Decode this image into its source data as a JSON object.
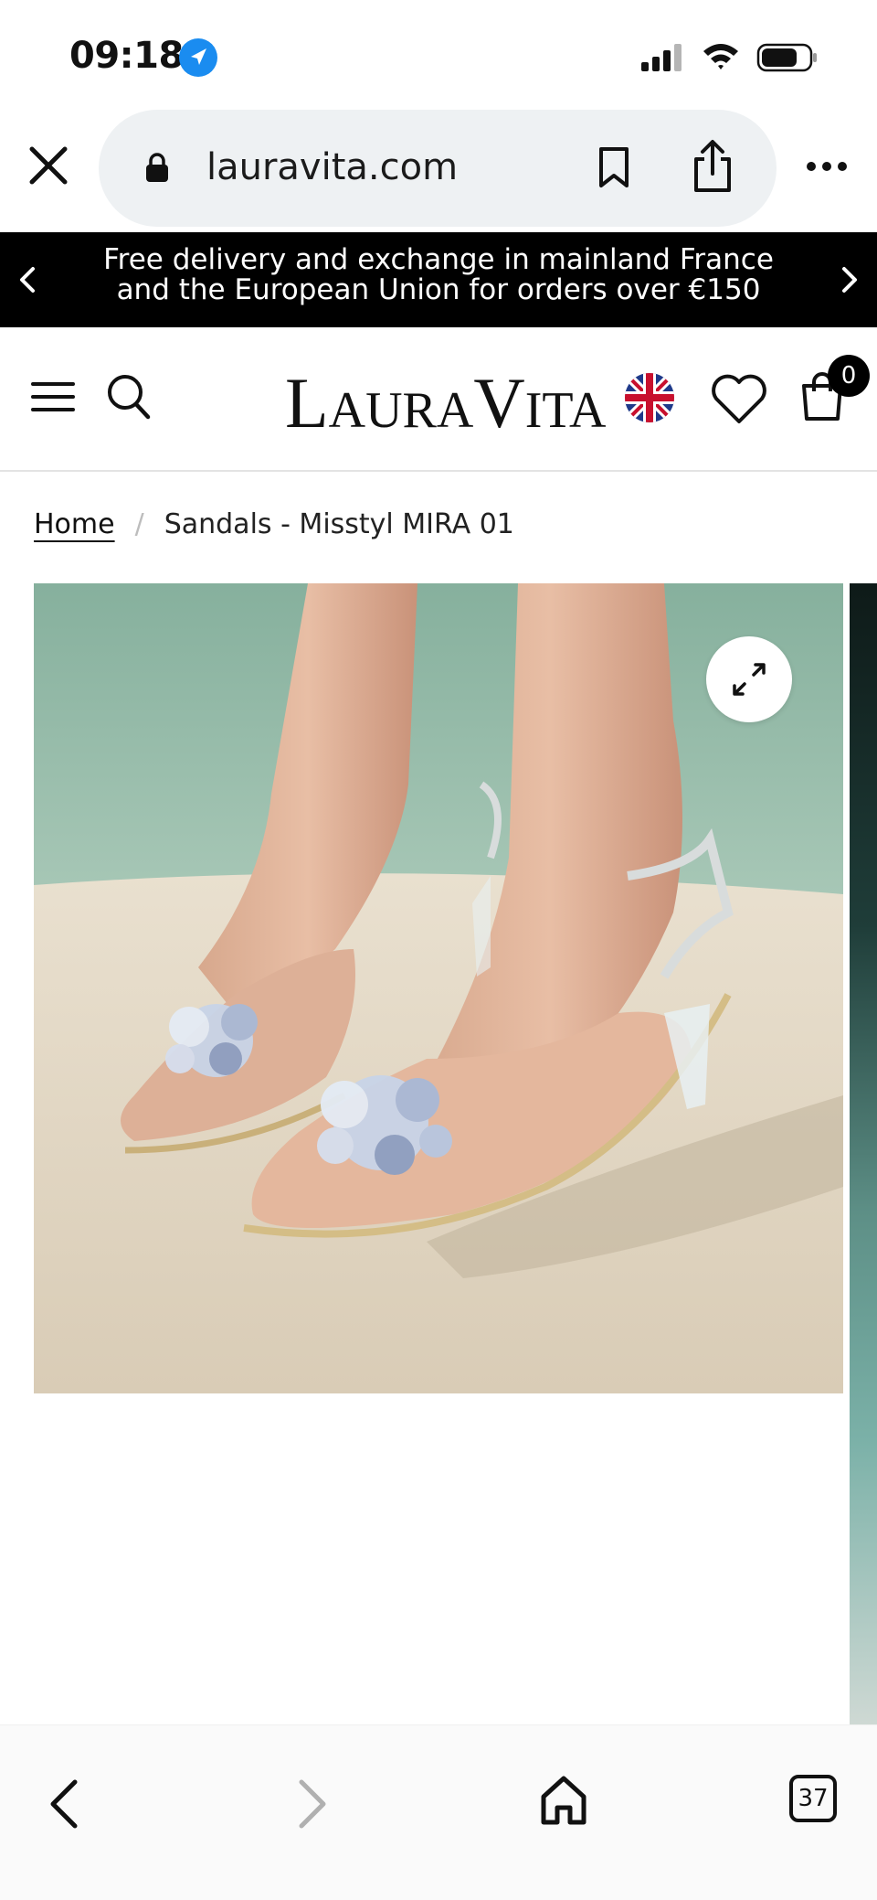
{
  "status_bar": {
    "time": "09:18",
    "icons": [
      "location-arrow-icon",
      "cellular-signal-icon",
      "wifi-icon",
      "battery-icon"
    ]
  },
  "browser": {
    "url": "lauravita.com",
    "icons": [
      "close-icon",
      "lock-icon",
      "bookmark-icon",
      "share-icon",
      "more-icon"
    ]
  },
  "promo_banner": {
    "text": "Free delivery and exchange in mainland France and the European Union for orders over €150"
  },
  "header": {
    "logo_parts": [
      "L",
      "AURA",
      "V",
      "ITA"
    ],
    "cart_count": "0",
    "icons": [
      "menu-icon",
      "search-icon",
      "uk-flag-icon",
      "heart-icon",
      "cart-icon"
    ]
  },
  "breadcrumb": {
    "home": "Home",
    "separator": "/",
    "current": "Sandals - Misstyl MIRA 01"
  },
  "toolbar": {
    "tab_count": "37",
    "icons": [
      "back-icon",
      "forward-icon",
      "home-icon",
      "tabs-icon"
    ]
  },
  "colors": {
    "promo_bg": "#000000",
    "url_pill_bg": "#eef1f3",
    "location_blue": "#1a8cf0",
    "wall_green": "#8fb5a3",
    "floor_cream": "#e8dcc6"
  }
}
